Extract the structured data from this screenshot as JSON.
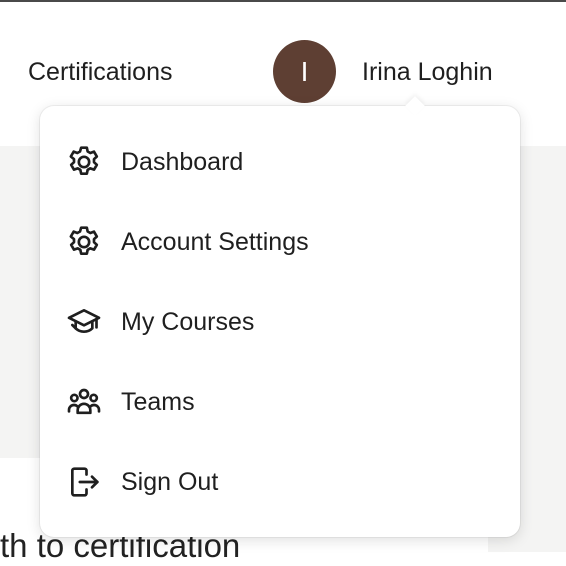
{
  "header": {
    "nav_link": "Certifications",
    "avatar_initial": "I",
    "user_name": "Irina Loghin"
  },
  "menu": {
    "items": [
      {
        "label": "Dashboard",
        "icon": "gear-icon"
      },
      {
        "label": "Account Settings",
        "icon": "gear-icon"
      },
      {
        "label": "My Courses",
        "icon": "graduation-cap-icon"
      },
      {
        "label": "Teams",
        "icon": "people-group-icon"
      },
      {
        "label": "Sign Out",
        "icon": "sign-out-icon"
      }
    ]
  },
  "page": {
    "partial_heading": "th to certification"
  },
  "colors": {
    "avatar_bg": "#5e3f33",
    "page_bg": "#f4f4f3",
    "text": "#1f1f1f"
  }
}
